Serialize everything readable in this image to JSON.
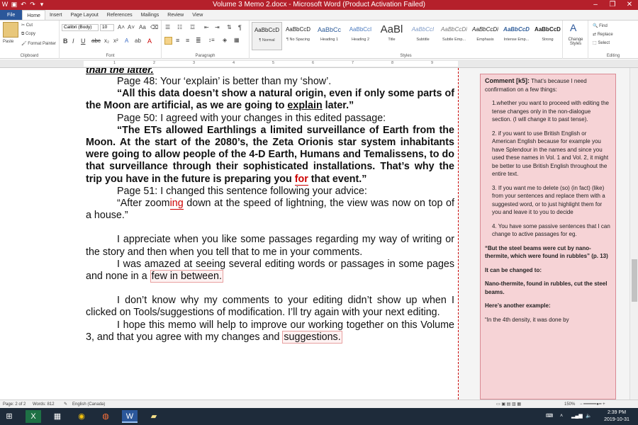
{
  "window": {
    "title": "Volume 3 Memo 2.docx  -  Microsoft Word (Product Activation Failed)",
    "controls": [
      "–",
      "❐",
      "✕"
    ]
  },
  "tabs": [
    "File",
    "Home",
    "Insert",
    "Page Layout",
    "References",
    "Mailings",
    "Review",
    "View"
  ],
  "ribbon": {
    "clipboard": {
      "paste": "Paste",
      "cut": "Cut",
      "copy": "Copy",
      "format_painter": "Format Painter",
      "label": "Clipboard"
    },
    "font": {
      "name": "Calibri (Body)",
      "size": "10",
      "label": "Font"
    },
    "paragraph": {
      "label": "Paragraph"
    },
    "styles": {
      "label": "Styles",
      "items": [
        {
          "preview": "AaBbCcD",
          "name": "¶ Normal"
        },
        {
          "preview": "AaBbCcD",
          "name": "¶ No Spacing"
        },
        {
          "preview": "AaBbCc",
          "name": "Heading 1"
        },
        {
          "preview": "AaBbCcI",
          "name": "Heading 2"
        },
        {
          "preview": "AaBl",
          "name": "Title"
        },
        {
          "preview": "AaBbCcI",
          "name": "Subtitle"
        },
        {
          "preview": "AaBbCcDi",
          "name": "Subtle Emp..."
        },
        {
          "preview": "AaBbCcDi",
          "name": "Emphasis"
        },
        {
          "preview": "AaBbCcD",
          "name": "Intense Emp..."
        },
        {
          "preview": "AaBbCcD",
          "name": "Strong"
        }
      ],
      "change": "Change Styles"
    },
    "editing": {
      "find": "Find",
      "replace": "Replace",
      "select": "Select",
      "label": "Editing"
    }
  },
  "document": {
    "cutoff": "than the latter.",
    "p1": "Page 48: Your ‘explain’ is better than my ‘show’.",
    "p2a": "“All this data doesn’t show a natural origin, even if only some parts of the Moon are artificial, as we are going to ",
    "p2b": "explain",
    "p2c": " later.”",
    "p3": "Page 50: I agreed with your changes in this edited passage:",
    "p4a": "“The ETs allowed Earthlings a limited surveillance of Earth from the Moon. At the start of the 2080’s, the Zeta Orionis star system inhabitants were going to allow people of the 4-D Earth, Humans and Temalissens, to do that surveillance through their sophisticated installations. That’s why the trip you have in the future is preparing you ",
    "p4b": "for",
    "p4c": " that event.”",
    "p5": "Page 51: I changed this sentence following your advice:",
    "p6a": "“After zoom",
    "p6b": "ing",
    "p6c": " down at the speed of lightning, the view was now on top of a house.”",
    "p7": "I appreciate when you like some passages regarding my way of writing or the story and then when you tell that to me in your comments.",
    "p8a": "I was amazed at seeing several editing words or passages in some pages and none in a ",
    "p8b": "few in between.",
    "p9": "I don’t know why my comments to your editing didn’t show up when I clicked on Tools/suggestions of modification. I’ll try again with your next editing.",
    "p10a": "I hope this memo will help to improve our working together on this Volume 3, and that you agree with my changes and ",
    "p10b": "suggestions."
  },
  "comment": {
    "header": "Comment [k5]:",
    "intro": " That’s because I need confirmation on a few things:",
    "item1": "1.whether you want to proceed with editing the tense changes only in the non-dialogue section. (I will change it to past tense).",
    "item2": "2. if you want to use British English or American English because for example you have Splendour in the names and since you used these names in Vol. 1 and Vol. 2, it might be better to use British English throughout the entire text.",
    "item3": "3. If you want me to delete (so) (in fact) (like) from your sentences and replace them with a suggested word, or to just highlight them for you and leave it to you to decide",
    "item4": "4. You have some passive sentences that I can change to active passages for eg.",
    "quote": "“But the steel beams were cut by nano-thermite, which were found in rubbles” (p. 13)",
    "changed": "It can be changed to:",
    "rewrite": "Nano-thermite, found in rubbles, cut the steel beams.",
    "another": "Here’s another example:",
    "example": "“In the 4th density, it was done by"
  },
  "status": {
    "page": "Page: 2 of 2",
    "words": "Words: 812",
    "language": "English (Canada)",
    "zoom": "150%"
  },
  "taskbar": {
    "time": "2:39 PM",
    "date": "2019-10-31"
  }
}
